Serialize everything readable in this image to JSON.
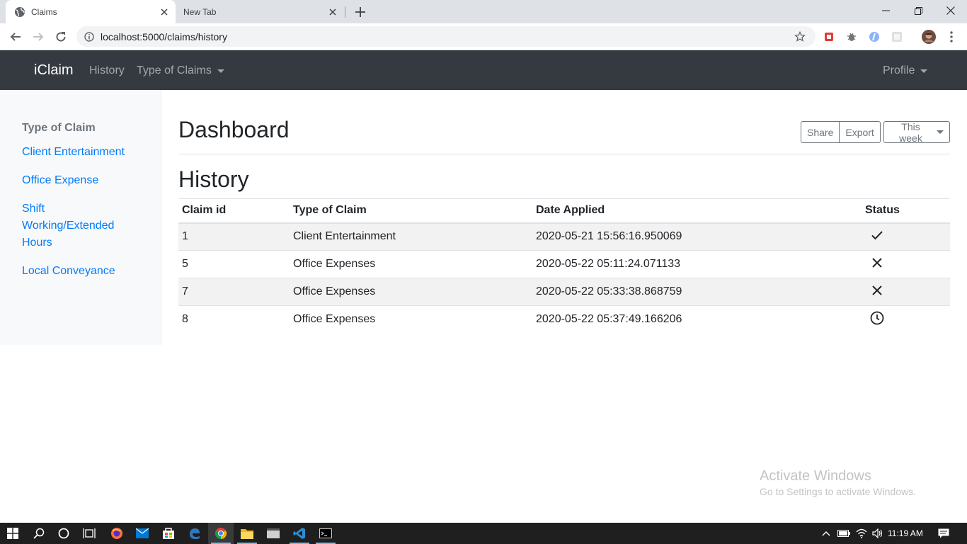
{
  "browser": {
    "tabs": [
      {
        "title": "Claims",
        "icon": "globe-icon"
      },
      {
        "title": "New Tab"
      }
    ],
    "url": "localhost:5000/claims/history"
  },
  "navbar": {
    "brand": "iClaim",
    "links": [
      "History",
      "Type of Claims"
    ],
    "profile": "Profile"
  },
  "sidebar": {
    "heading": "Type of Claim",
    "items": [
      "Client Entertainment",
      "Office Expense",
      "Shift Working/Extended Hours",
      "Local Conveyance"
    ]
  },
  "main": {
    "title": "Dashboard",
    "buttons": {
      "share": "Share",
      "export": "Export",
      "range": "This week"
    },
    "section_title": "History",
    "table": {
      "headers": [
        "Claim id",
        "Type of Claim",
        "Date Applied",
        "Status"
      ],
      "rows": [
        {
          "id": "1",
          "type": "Client Entertainment",
          "date": "2020-05-21 15:56:16.950069",
          "status": "check-icon"
        },
        {
          "id": "5",
          "type": "Office Expenses",
          "date": "2020-05-22 05:11:24.071133",
          "status": "x-icon"
        },
        {
          "id": "7",
          "type": "Office Expenses",
          "date": "2020-05-22 05:33:38.868759",
          "status": "x-icon"
        },
        {
          "id": "8",
          "type": "Office Expenses",
          "date": "2020-05-22 05:37:49.166206",
          "status": "clock-icon"
        }
      ]
    }
  },
  "watermark": {
    "line1": "Activate Windows",
    "line2": "Go to Settings to activate Windows."
  },
  "taskbar": {
    "time": "11:19 AM"
  },
  "colors": {
    "navbar_bg": "#343a40",
    "link": "#007bff",
    "sidebar_bg": "#f8f9fa"
  }
}
